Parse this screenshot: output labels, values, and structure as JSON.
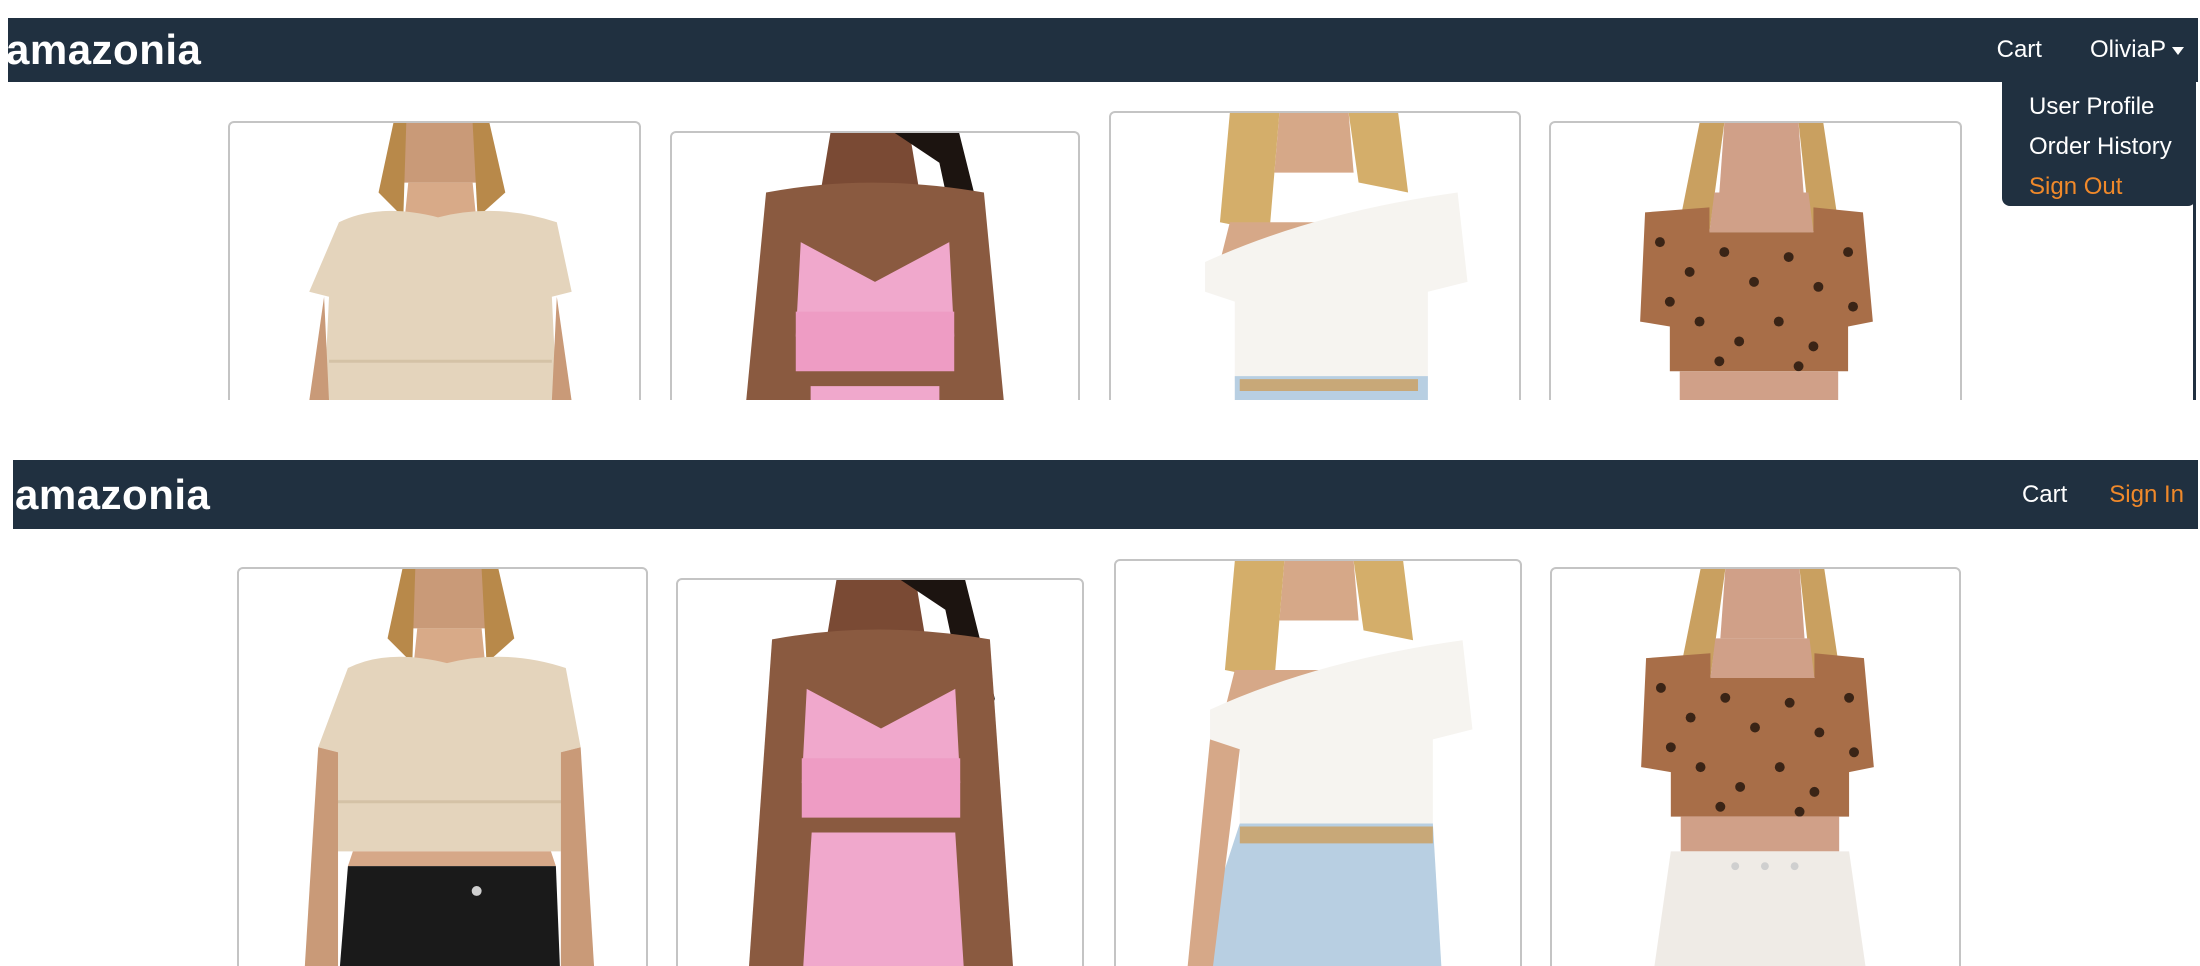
{
  "brand": "amazonia",
  "header_top": {
    "cart_label": "Cart",
    "user_label": "OliviaP",
    "menu": [
      {
        "label": "User Profile"
      },
      {
        "label": "Order History"
      },
      {
        "label": "Sign Out"
      }
    ]
  },
  "header_bottom": {
    "cart_label": "Cart",
    "signin_label": "Sign In"
  },
  "products": [
    {
      "name": "beige knit crop top"
    },
    {
      "name": "pink knit bralette"
    },
    {
      "name": "white off-shoulder top"
    },
    {
      "name": "leopard print crop top"
    }
  ],
  "colors": {
    "navbar": "#203040",
    "accent": "#f0892a",
    "card_border": "#c4c4c4"
  }
}
